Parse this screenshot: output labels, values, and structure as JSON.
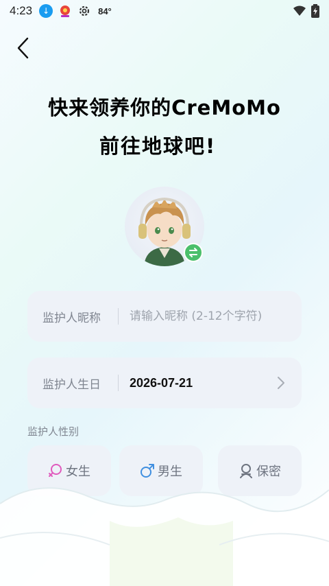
{
  "status_bar": {
    "time": "4:23",
    "temperature": "84°",
    "icons": [
      "download-icon",
      "app-notification-icon",
      "settings-icon",
      "wifi-icon",
      "battery-icon"
    ]
  },
  "header": {
    "back_icon": "chevron-left-icon",
    "title_line1": "快来领养你的CreMoMo",
    "title_line2": "前往地球吧!"
  },
  "avatar": {
    "switch_icon": "swap-icon",
    "badge_color": "#4bbf6b"
  },
  "form": {
    "nickname": {
      "label": "监护人昵称",
      "placeholder": "请输入昵称 (2-12个字符)",
      "value": ""
    },
    "birthday": {
      "label": "监护人生日",
      "value": "2026-07-21",
      "icon": "chevron-right-icon"
    },
    "gender": {
      "label": "监护人性别",
      "options": [
        {
          "label": "女生",
          "icon": "female-icon",
          "color": "#e05bbd"
        },
        {
          "label": "男生",
          "icon": "male-icon",
          "color": "#3f8fe0"
        },
        {
          "label": "保密",
          "icon": "secret-icon",
          "color": "#6e7480"
        }
      ]
    }
  }
}
